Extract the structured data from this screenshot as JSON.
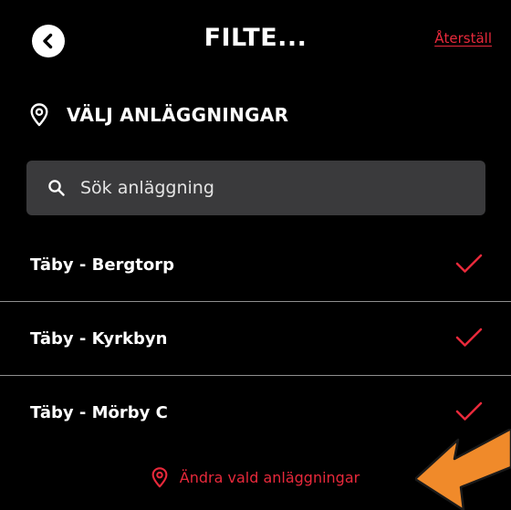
{
  "header": {
    "title": "FILTE...",
    "reset_label": "Återställ"
  },
  "section": {
    "heading": "VÄLJ ANLÄGGNINGAR"
  },
  "search": {
    "placeholder": "Sök anläggning",
    "value": ""
  },
  "facilities": [
    {
      "name": "Täby - Bergtorp",
      "selected": true
    },
    {
      "name": "Täby - Kyrkbyn",
      "selected": true
    },
    {
      "name": "Täby - Mörby C",
      "selected": true
    }
  ],
  "footer": {
    "change_label": "Ändra vald anläggningar"
  },
  "icons": {
    "back": "chevron-left-circle-icon",
    "location": "location-pin-icon",
    "search": "search-icon",
    "check": "checkmark-icon",
    "annotation": "arrow-annotation-icon"
  },
  "colors": {
    "background": "#000000",
    "accent": "#e8293b",
    "search_bg": "#3a3a3c",
    "divider": "#8f8f8f",
    "annotation_arrow": "#f08a2a"
  }
}
